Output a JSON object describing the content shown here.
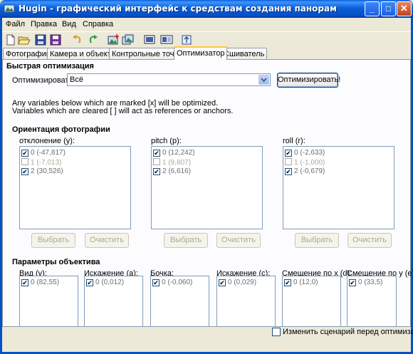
{
  "window": {
    "title": "Hugin - графический интерфейс к средствам создания панорам",
    "minimize": "_",
    "maximize": "□",
    "close": "✕"
  },
  "menu": [
    "Файл",
    "Правка",
    "Вид",
    "Справка"
  ],
  "toolbar_icons": [
    "new-icon",
    "open-icon",
    "save-icon",
    "save-as-icon",
    "undo-icon",
    "redo-icon",
    "add-images-icon",
    "add-time-series-icon",
    "preview-icon",
    "gl-preview-icon",
    "fit-icon"
  ],
  "tabs": [
    "Фотографии",
    "Камера и объектив",
    "Контрольные точки",
    "Оптимизатор",
    "Сшиватель"
  ],
  "active_tab": 3,
  "quick": {
    "heading": "Быстрая оптимизация",
    "label": "Оптимизировать",
    "selected": "Всё",
    "button": "Оптимизировать!"
  },
  "info_lines": [
    "Any variables below which are marked [x] will be optimized.",
    "Variables which are cleared [ ] will act as references or anchors."
  ],
  "orientation": {
    "heading": "Ориентация фотографии",
    "columns": [
      {
        "label": "отклонение (y):",
        "items": [
          {
            "text": "0 (-47,817)",
            "checked": true
          },
          {
            "text": "1 (-7,013)",
            "checked": false
          },
          {
            "text": "2 (30,526)",
            "checked": true
          }
        ],
        "select": "Выбрать",
        "clear": "Очистить"
      },
      {
        "label": "pitch (p):",
        "items": [
          {
            "text": "0 (12,242)",
            "checked": true
          },
          {
            "text": "1 (9,807)",
            "checked": false
          },
          {
            "text": "2 (6,616)",
            "checked": true
          }
        ],
        "select": "Выбрать",
        "clear": "Очистить"
      },
      {
        "label": "roll (r):",
        "items": [
          {
            "text": "0 (-2,633)",
            "checked": true
          },
          {
            "text": "1 (-1,000)",
            "checked": false
          },
          {
            "text": "2 (-0,679)",
            "checked": true
          }
        ],
        "select": "Выбрать",
        "clear": "Очистить"
      }
    ]
  },
  "lens": {
    "heading": "Параметры объектива",
    "columns": [
      {
        "label": "Вид (v):",
        "item": "0 (82,55)",
        "checked": true
      },
      {
        "label": "Искажение (a):",
        "item": "0 (0,012)",
        "checked": true
      },
      {
        "label": "Бочка:",
        "item": "0 (-0,060)",
        "checked": true
      },
      {
        "label": "Искажение (c):",
        "item": "0 (0,029)",
        "checked": true
      },
      {
        "label": "Смещение по x (d):",
        "item": "0 (12,0)",
        "checked": true
      },
      {
        "label": "Смещение по y (e):",
        "item": "0 (33,5)",
        "checked": true
      }
    ]
  },
  "edit_script": {
    "label": "Изменить сценарий перед оптимизацией",
    "checked": false
  }
}
